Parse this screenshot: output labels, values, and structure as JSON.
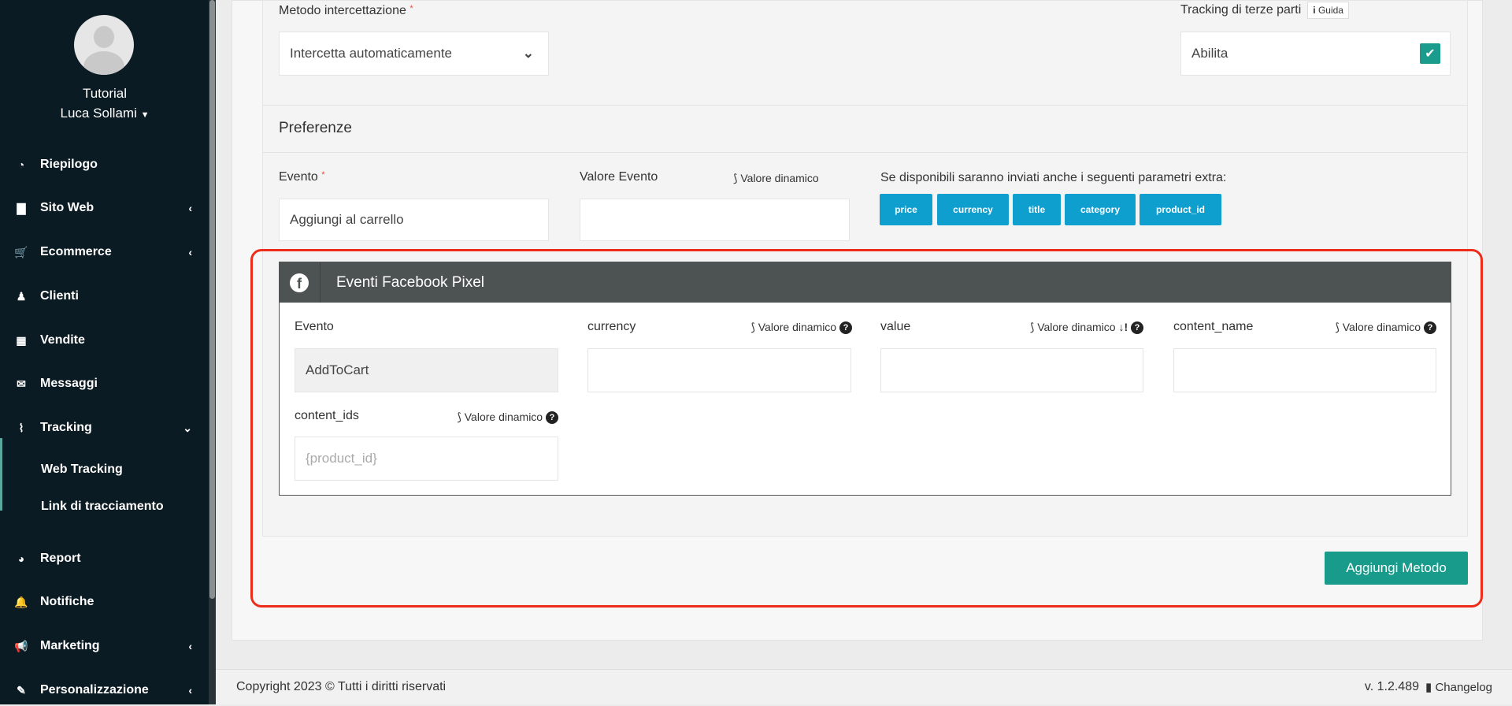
{
  "sidebar": {
    "org": "Tutorial",
    "user": "Luca Sollami",
    "items": [
      {
        "label": "Riepilogo",
        "icon": "dashboard-icon",
        "chev": ""
      },
      {
        "label": "Sito Web",
        "icon": "file-icon",
        "chev": "‹"
      },
      {
        "label": "Ecommerce",
        "icon": "cart-icon",
        "chev": "‹"
      },
      {
        "label": "Clienti",
        "icon": "person-icon",
        "chev": ""
      },
      {
        "label": "Vendite",
        "icon": "calculator-icon",
        "chev": ""
      },
      {
        "label": "Messaggi",
        "icon": "envelope-icon",
        "chev": ""
      },
      {
        "label": "Tracking",
        "icon": "chart-line-icon",
        "chev": "⌄"
      },
      {
        "label": "Report",
        "icon": "pie-chart-icon",
        "chev": ""
      },
      {
        "label": "Notifiche",
        "icon": "bell-icon",
        "chev": ""
      },
      {
        "label": "Marketing",
        "icon": "megaphone-icon",
        "chev": "‹"
      },
      {
        "label": "Personalizzazione",
        "icon": "brush-icon",
        "chev": "‹"
      }
    ],
    "sub": [
      "Web Tracking",
      "Link di tracciamento"
    ]
  },
  "form": {
    "metodo_label": "Metodo intercettazione",
    "metodo_value": "Intercetta automaticamente",
    "terze_label": "Tracking di terze parti",
    "guida": "Guida",
    "terze_value": "Abilita",
    "terze_checked": true,
    "preferenze": "Preferenze",
    "evento_label": "Evento",
    "evento_value": "Aggiungi al carrello",
    "valore_label": "Valore Evento",
    "dyn": "Valore dinamico",
    "extra_label": "Se disponibili saranno inviati anche i seguenti parametri extra:",
    "params": [
      "price",
      "currency",
      "title",
      "category",
      "product_id"
    ]
  },
  "fb": {
    "title": "Eventi Facebook Pixel",
    "evento_label": "Evento",
    "evento_value": "AddToCart",
    "currency": "currency",
    "value": "value",
    "content_name": "content_name",
    "content_ids": "content_ids",
    "content_ids_placeholder": "{product_id}",
    "dyn": "Valore dinamico"
  },
  "actions": {
    "add": "Aggiungi Metodo"
  },
  "footer": {
    "copyright": "Copyright 2023 © Tutti i diritti riservati",
    "version": "v. 1.2.489",
    "changelog": "Changelog"
  },
  "colors": {
    "accent": "#189b8a",
    "param": "#0e9fcf",
    "highlight": "#ee2c1a"
  }
}
